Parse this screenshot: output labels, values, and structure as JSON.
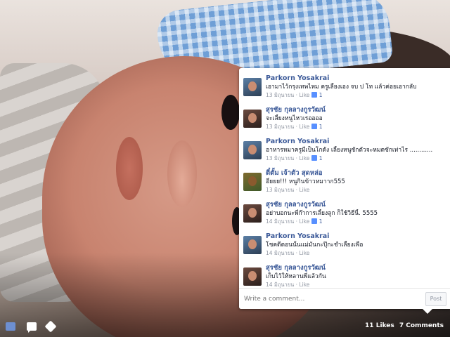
{
  "comments": [
    {
      "author": "Parkorn Yosakrai",
      "text": "เอามาไว้กรุงเทพไหม ครูเลี้ยงเอง จบ ป โท แล้วค่อยเอากลับ",
      "time": "13 มิถุนายน",
      "like_label": "Like",
      "likes": "1",
      "avatar": "user-photo"
    },
    {
      "author": "สุรชัย กุลลางกูรวัฒน์",
      "text": "จะเลี้ยงหนูไหวเรออออ",
      "time": "13 มิถุนายน",
      "like_label": "Like",
      "likes": "1",
      "avatar": "user-photo"
    },
    {
      "author": "Parkorn Yosakrai",
      "text": "อาหารหมาครูมีเป็นโกดัง เลี้ยงหนูซักตัวจะหมดซักเท่าไร ............",
      "time": "13 มิถุนายน",
      "like_label": "Like",
      "likes": "1",
      "avatar": "user-photo"
    },
    {
      "author": "ตี๋ตั้ม เจ้าตัว สุดหล่อ",
      "text": "อี๋ยยย!!! หนูกินข้าวหมาาก555",
      "time": "13 มิถุนายน",
      "like_label": "Like",
      "likes": "",
      "avatar": "dog-photo"
    },
    {
      "author": "สุรชัย กุลลางกูรวัฒน์",
      "text": "อย่าบอกนะพี่ก๊าการเลี้ยงลูก ก็ใช้วิธีนี้. 5555",
      "time": "14 มิถุนายน",
      "like_label": "Like",
      "likes": "1",
      "avatar": "user-photo"
    },
    {
      "author": "Parkorn Yosakrai",
      "text": "โชคดีตอนนั้นแม่มันกะปุ๊กะช่ำเลี้ยงเพือ",
      "time": "14 มิถุนายน",
      "like_label": "Like",
      "likes": "",
      "avatar": "user-photo"
    },
    {
      "author": "สุรชัย กุลลางกูรวัฒน์",
      "text": "เก็บไว้ให้หลานพี่แล้วกัน",
      "time": "14 มิถุนายน",
      "like_label": "Like",
      "likes": "",
      "avatar": "user-photo"
    }
  ],
  "composer": {
    "placeholder": "Write a comment...",
    "post_label": "Post"
  },
  "footer": {
    "likes": "11 Likes",
    "comments": "7 Comments"
  },
  "colors": {
    "link": "#3b5998",
    "meta": "#9197a3",
    "like_blue": "#5890ff"
  }
}
